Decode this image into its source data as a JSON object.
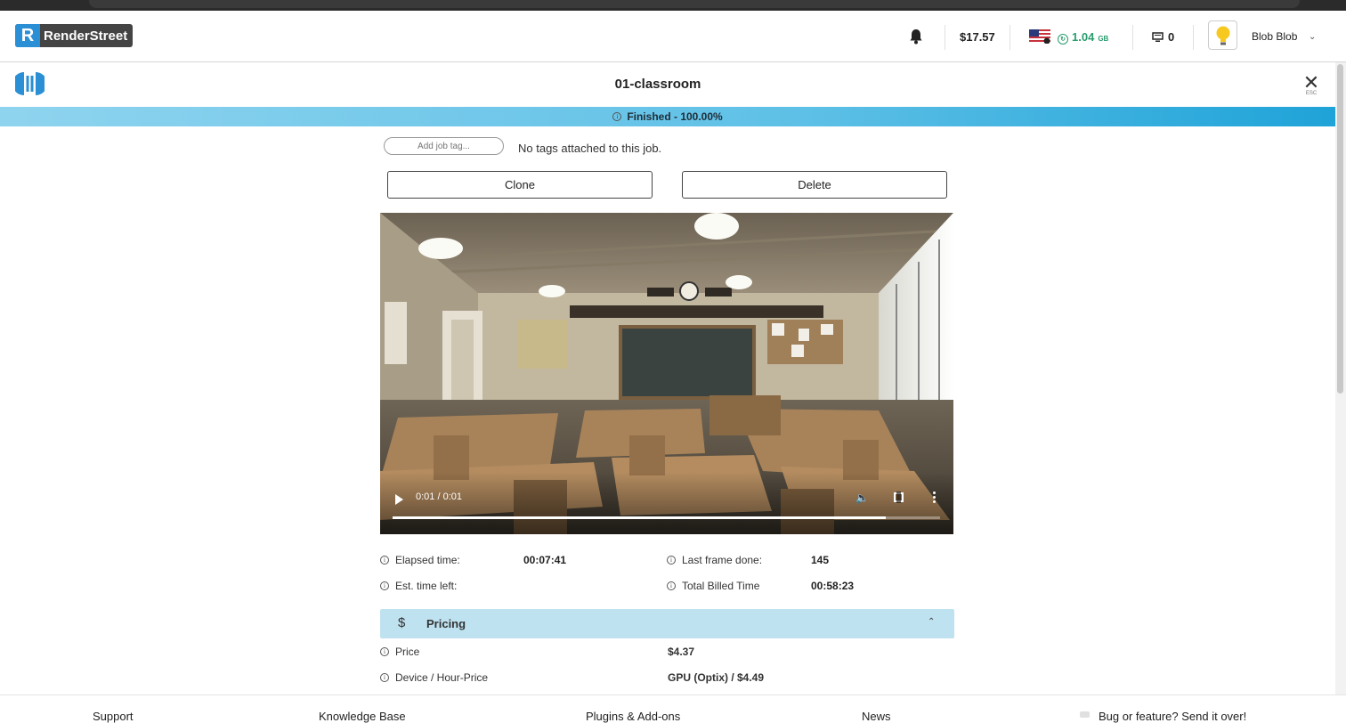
{
  "header": {
    "logo_text": "RenderStreet",
    "balance": "$17.57",
    "bandwidth_value": "1.04",
    "bandwidth_unit": "GB",
    "machines_count": "0",
    "user_name": "Blob Blob"
  },
  "job": {
    "title": "01-classroom",
    "close_label": "ESC",
    "status": "Finished - 100.00%",
    "tag_placeholder": "Add job tag...",
    "no_tags_text": "No tags attached to this job.",
    "clone_label": "Clone",
    "delete_label": "Delete"
  },
  "video": {
    "time": "0:01 / 0:01",
    "progress": 0.9
  },
  "stats": {
    "elapsed_label": "Elapsed time:",
    "elapsed_value": "00:07:41",
    "last_frame_label": "Last frame done:",
    "last_frame_value": "145",
    "est_left_label": "Est. time left:",
    "est_left_value": "",
    "billed_label": "Total Billed Time",
    "billed_value": "00:58:23"
  },
  "pricing": {
    "title": "Pricing",
    "price_label": "Price",
    "price_value": "$4.37",
    "device_label": "Device / Hour-Price",
    "device_value": "GPU (Optix) / $4.49"
  },
  "footer": {
    "support": "Support",
    "knowledge_base": "Knowledge Base",
    "plugins": "Plugins & Add-ons",
    "news": "News",
    "bug": "Bug or feature? Send it over!"
  },
  "colors": {
    "accent": "#1fa3d8",
    "pricing_bg": "#bfe2f1",
    "bandwidth_green": "#2a9d6e"
  }
}
